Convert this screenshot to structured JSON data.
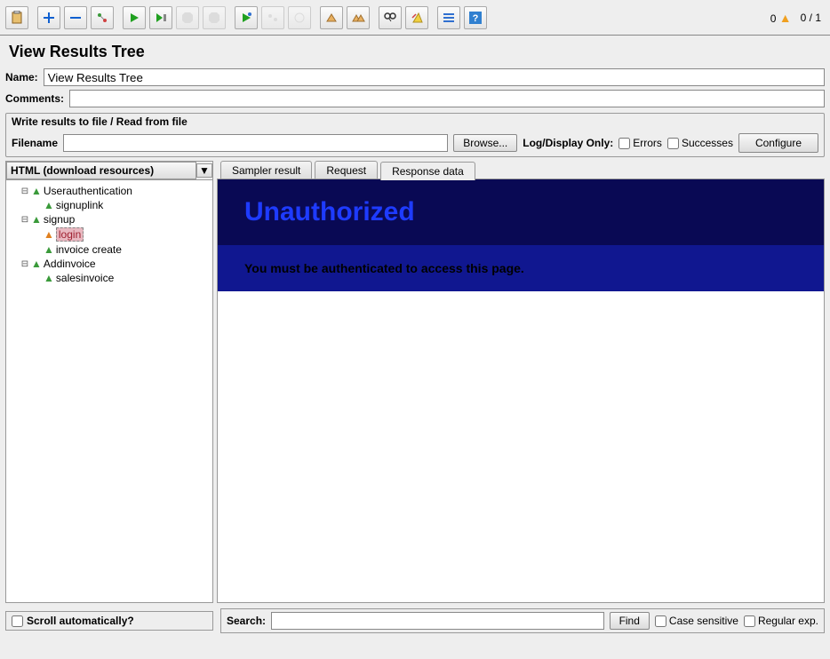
{
  "toolbar": {
    "status_errors": "0",
    "status_tests": "0 / 1"
  },
  "panel": {
    "title": "View Results Tree"
  },
  "fields": {
    "name_label": "Name:",
    "name_value": "View Results Tree",
    "comments_label": "Comments:",
    "comments_value": "",
    "file_legend": "Write results to file / Read from file",
    "filename_label": "Filename",
    "filename_value": "",
    "browse": "Browse...",
    "logdisplay": "Log/Display Only:",
    "errors_chk": "Errors",
    "successes_chk": "Successes",
    "configure": "Configure"
  },
  "renderer": {
    "selected": "HTML (download resources)"
  },
  "tree": {
    "items": [
      {
        "label": "Userauthentication"
      },
      {
        "label": "signuplink"
      },
      {
        "label": "signup"
      },
      {
        "label": "login"
      },
      {
        "label": "invoice create"
      },
      {
        "label": "Addinvoice"
      },
      {
        "label": "salesinvoice"
      }
    ]
  },
  "tabs": {
    "sampler": "Sampler result",
    "request": "Request",
    "response": "Response data"
  },
  "response": {
    "heading": "Unauthorized",
    "message": "You must be authenticated to access this page."
  },
  "bottom": {
    "scroll_auto": "Scroll automatically?",
    "search_label": "Search:",
    "find": "Find",
    "case_sensitive": "Case sensitive",
    "regex": "Regular exp."
  }
}
